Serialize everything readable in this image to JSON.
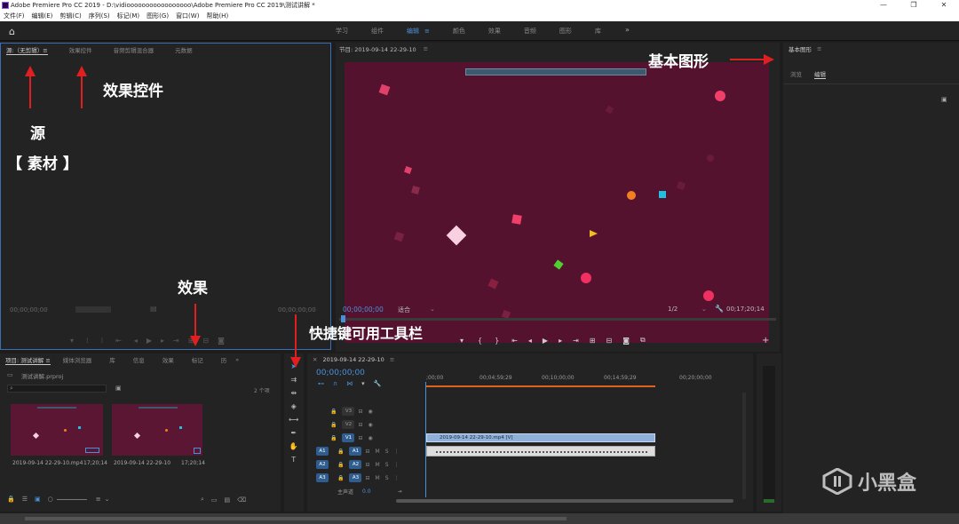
{
  "window": {
    "title": "Adobe Premiere Pro CC 2019 - D:\\vidiooooooooooooooooo\\Adobe Premiere Pro CC 2019\\测试讲解 *",
    "controls": [
      "—",
      "❐",
      "✕"
    ]
  },
  "menu": [
    "文件(F)",
    "编辑(E)",
    "剪辑(C)",
    "序列(S)",
    "标记(M)",
    "图形(G)",
    "窗口(W)",
    "帮助(H)"
  ],
  "workspaces": {
    "tabs": [
      "学习",
      "组件",
      "编辑",
      "颜色",
      "效果",
      "音频",
      "图形",
      "库"
    ],
    "active_index": 2,
    "more": "»"
  },
  "source_panel": {
    "tabs": [
      "源:（无剪辑）≡",
      "效果控件",
      "音频剪辑混合器",
      "元数据"
    ],
    "timecode_left": "00;00;00;00",
    "timecode_right": "00;00;00;00"
  },
  "program_panel": {
    "title": "节目: 2019-09-14 22-29-10",
    "menu": "≡",
    "timecode": "00;00;00;00",
    "fit": "适合",
    "resolution": "1/2",
    "duration": "00;17;20;14"
  },
  "essential_graphics": {
    "title": "基本图形",
    "menu": "≡",
    "tabs": [
      "浏览",
      "编辑"
    ],
    "active_tab": 1
  },
  "project_panel": {
    "tabs": [
      "项目: 测试讲解 ≡",
      "媒体浏览器",
      "库",
      "信息",
      "效果",
      "标记",
      "历"
    ],
    "more": "»",
    "project_file": "测试讲解.prproj",
    "item_count": "2 个项",
    "items": [
      {
        "name": "2019-09-14 22-29-10.mp4",
        "duration": "17;20;14"
      },
      {
        "name": "2019-09-14 22-29-10",
        "duration": "17;20;14"
      }
    ]
  },
  "timeline": {
    "sequence_name": "2019-09-14 22-29-10",
    "timecode": "00;00;00;00",
    "ruler": [
      ";00;00",
      "00;04;59;29",
      "00;10;00;00",
      "00;14;59;29",
      "00;20;00;00"
    ],
    "tracks": [
      {
        "name": "V3",
        "type": "video"
      },
      {
        "name": "V2",
        "type": "video"
      },
      {
        "name": "V1",
        "type": "video",
        "clip": "2019-09-14 22-29-10.mp4 [V]"
      },
      {
        "name": "A1",
        "type": "audio",
        "clip": ""
      },
      {
        "name": "A2",
        "type": "audio"
      },
      {
        "name": "A3",
        "type": "audio"
      }
    ],
    "master": {
      "label": "主声道",
      "value": "0.0"
    }
  },
  "annotations": {
    "source": "源",
    "material": "【 素材 】",
    "effect_controls": "效果控件",
    "effects": "效果",
    "shortcut_tools": "快捷键可用工具栏",
    "essential": "基本图形"
  },
  "watermark": "小黑盒",
  "colors": {
    "accent": "#4a90d9",
    "video_bg": "#54122f",
    "arrow": "#e02020",
    "clip_video": "#8fb0d8"
  }
}
